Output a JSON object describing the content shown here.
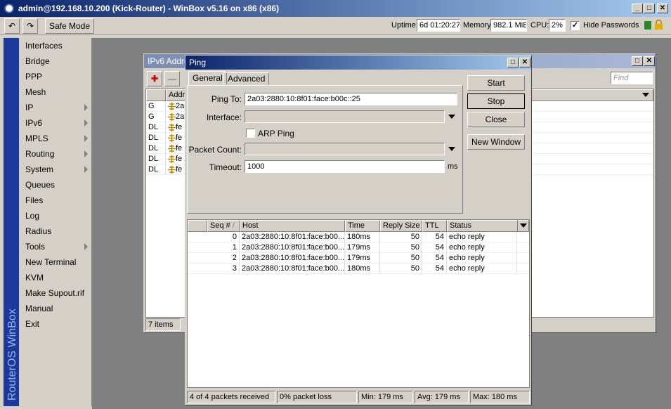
{
  "app": {
    "title": "admin@192.168.10.200 (Kick-Router) - WinBox v5.16 on x86 (x86)",
    "brand": "RouterOS WinBox",
    "caption_min": "_",
    "caption_max": "□",
    "caption_close": "✕"
  },
  "toolbar": {
    "undo": "↶",
    "redo": "↷",
    "safe_mode": "Safe Mode",
    "uptime_label": "Uptime:",
    "uptime_value": "6d 01:20:27",
    "memory_label": "Memory:",
    "memory_value": "982.1 MiB",
    "cpu_label": "CPU:",
    "cpu_value": "2%",
    "hide_passwords_label": "Hide Passwords",
    "hide_passwords_checked": "✓",
    "status_color": "#2a8a2a",
    "lock_color": "#e0b000"
  },
  "menu": {
    "items": [
      {
        "label": "Interfaces",
        "sub": false
      },
      {
        "label": "Bridge",
        "sub": false
      },
      {
        "label": "PPP",
        "sub": false
      },
      {
        "label": "Mesh",
        "sub": false
      },
      {
        "label": "IP",
        "sub": true
      },
      {
        "label": "IPv6",
        "sub": true
      },
      {
        "label": "MPLS",
        "sub": true
      },
      {
        "label": "Routing",
        "sub": true
      },
      {
        "label": "System",
        "sub": true
      },
      {
        "label": "Queues",
        "sub": false
      },
      {
        "label": "Files",
        "sub": false
      },
      {
        "label": "Log",
        "sub": false
      },
      {
        "label": "Radius",
        "sub": false
      },
      {
        "label": "Tools",
        "sub": true
      },
      {
        "label": "New Terminal",
        "sub": false
      },
      {
        "label": "KVM",
        "sub": false
      },
      {
        "label": "Make Supout.rif",
        "sub": false
      },
      {
        "label": "Manual",
        "sub": false
      },
      {
        "label": "Exit",
        "sub": false
      }
    ]
  },
  "ipv6_window": {
    "title": "IPv6 Addre",
    "add": "✚",
    "remove": "—",
    "find_placeholder": "Find",
    "col_address": "Addre",
    "rows": [
      {
        "flag": "G",
        "addr": "2a"
      },
      {
        "flag": "G",
        "addr": "2a"
      },
      {
        "flag": "DL",
        "addr": "fe"
      },
      {
        "flag": "DL",
        "addr": "fe"
      },
      {
        "flag": "DL",
        "addr": "fe"
      },
      {
        "flag": "DL",
        "addr": "fe"
      },
      {
        "flag": "DL",
        "addr": "fe"
      }
    ],
    "item_count": "7 items"
  },
  "ping": {
    "title": "Ping",
    "tabs": [
      "General",
      "Advanced"
    ],
    "ping_to_label": "Ping To:",
    "ping_to_value": "2a03:2880:10:8f01:face:b00c::25",
    "interface_label": "Interface:",
    "interface_value": "",
    "arp_ping_label": "ARP Ping",
    "packet_count_label": "Packet Count:",
    "packet_count_value": "",
    "timeout_label": "Timeout:",
    "timeout_value": "1000",
    "timeout_unit": "ms",
    "buttons": {
      "start": "Start",
      "stop": "Stop",
      "close": "Close",
      "new_window": "New Window"
    },
    "columns": [
      "Seq #",
      "Host",
      "Time",
      "Reply Size",
      "TTL",
      "Status"
    ],
    "sort_marker": "/",
    "results": [
      {
        "seq": "0",
        "host": "2a03:2880:10:8f01:face:b00...",
        "time": "180ms",
        "size": "50",
        "ttl": "54",
        "status": "echo reply"
      },
      {
        "seq": "1",
        "host": "2a03:2880:10:8f01:face:b00...",
        "time": "179ms",
        "size": "50",
        "ttl": "54",
        "status": "echo reply"
      },
      {
        "seq": "2",
        "host": "2a03:2880:10:8f01:face:b00...",
        "time": "179ms",
        "size": "50",
        "ttl": "54",
        "status": "echo reply"
      },
      {
        "seq": "3",
        "host": "2a03:2880:10:8f01:face:b00...",
        "time": "180ms",
        "size": "50",
        "ttl": "54",
        "status": "echo reply"
      }
    ],
    "status": {
      "received": "4 of 4 packets received",
      "loss": "0% packet loss",
      "min": "Min: 179 ms",
      "avg": "Avg: 179 ms",
      "max": "Max: 180 ms"
    }
  }
}
